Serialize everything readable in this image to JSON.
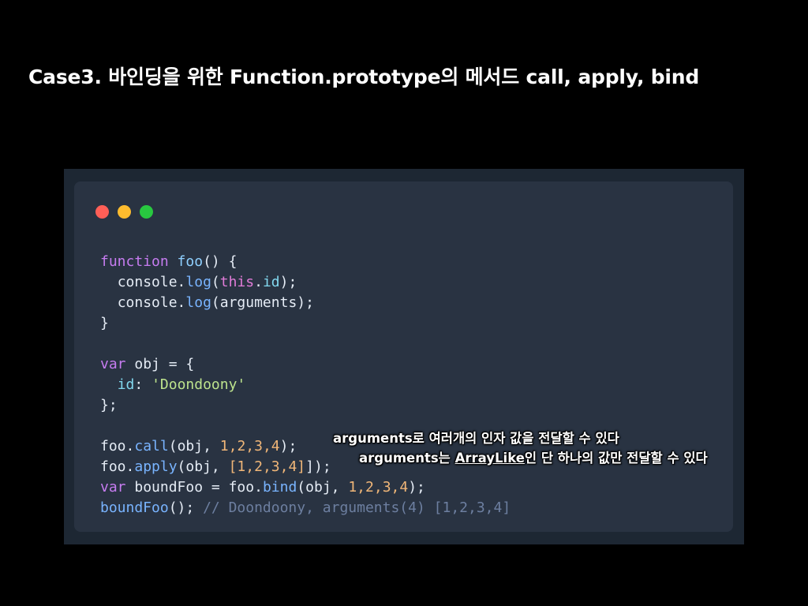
{
  "title": "Case3. 바인딩을 위한 Function.prototype의 메서드 call, apply, bind",
  "colors": {
    "background": "#000000",
    "frame": "#1d2733",
    "window": "#293342",
    "dot_red": "#ff5f57",
    "dot_yellow": "#febc2e",
    "dot_green": "#28c840"
  },
  "window_controls": [
    "close-dot",
    "minimize-dot",
    "maximize-dot"
  ],
  "code": {
    "kw_function": "function",
    "foo": "foo",
    "parens_open": "() {",
    "console": "console",
    "dot": ".",
    "log": "log",
    "this": "this",
    "id": "id",
    "arguments": "arguments",
    "close_brace": "}",
    "var": "var",
    "obj": "obj",
    "eq_brace": " = {",
    "id_key": "id",
    "doondoony_str": "'Doondoony'",
    "close_brace_semi": "};",
    "call": "call",
    "apply": "apply",
    "bind": "bind",
    "boundFoo": "boundFoo",
    "args_1234": "1,2,3,4",
    "array_1234": "[1,2,3,4]",
    "comment": "// Doondoony, arguments(4) [1,2,3,4]"
  },
  "annotations": {
    "call_note": "arguments로 여러개의 인자 값을 전달할 수 있다",
    "apply_prefix": "arguments는 ",
    "apply_link": "ArrayLike",
    "apply_suffix": "인 단 하나의 값만 전달할 수 있다"
  }
}
